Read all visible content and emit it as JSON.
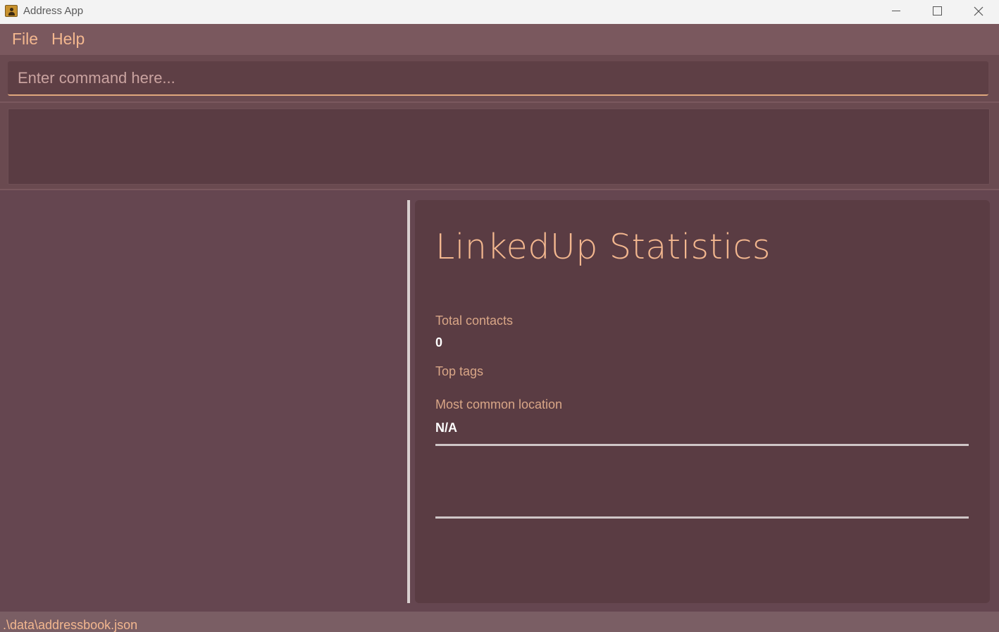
{
  "window": {
    "title": "Address App",
    "icon": "address-book-icon"
  },
  "menu": {
    "file": "File",
    "help": "Help"
  },
  "command": {
    "value": "",
    "placeholder": "Enter command here..."
  },
  "result": {
    "text": ""
  },
  "stats": {
    "title": "LinkedUp Statistics",
    "total_contacts_label": "Total contacts",
    "total_contacts_value": "0",
    "top_tags_label": "Top tags",
    "most_common_location_label": "Most common location",
    "most_common_location_value": "N/A"
  },
  "status": {
    "path": ".\\data\\addressbook.json"
  },
  "colors": {
    "background": "#6a4a50",
    "panel": "#5a3c43",
    "accent_text": "#f3b78f",
    "value_text": "#ffffff"
  }
}
